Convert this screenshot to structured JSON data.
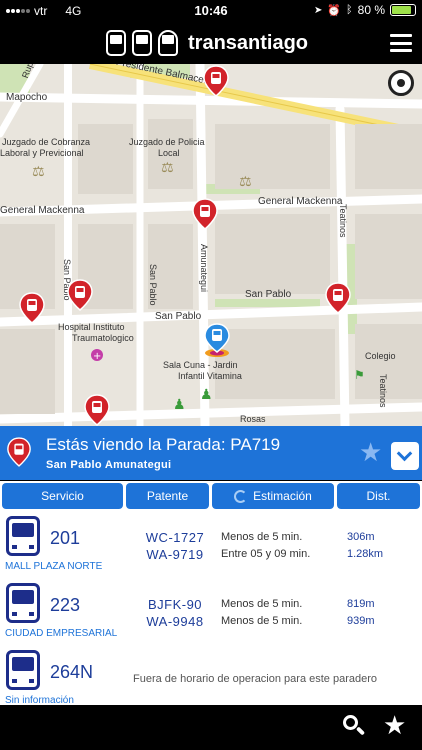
{
  "status_bar": {
    "carrier": "vtr",
    "network": "4G",
    "time": "10:46",
    "battery_text": "80 %"
  },
  "header": {
    "app_name": "transantiago"
  },
  "map": {
    "street_labels": [
      "Presidente Balmaceda",
      "Mapocho",
      "General Mackenna",
      "General Mackenna",
      "San Pablo",
      "San Pablo",
      "Teatinos",
      "Amunategui",
      "San Pablo",
      "San Pablo",
      "Teatinos",
      "Rosas"
    ],
    "place_labels": [
      "Juzgado de Cobranza",
      "Laboral y Previcional",
      "Juzgado de Policia",
      "Local",
      "Hospital Instituto",
      "Traumatologico",
      "Sala Cuna - Jardin",
      "Infantil Vitamina",
      "Colegio",
      "Ruperto Huerta"
    ]
  },
  "stop": {
    "title": "Estás viendo la Parada: PA719",
    "subtitle": "San Pablo Amunategui"
  },
  "table": {
    "headers": [
      "Servicio",
      "Patente",
      "Estimación",
      "Dist."
    ],
    "rows": [
      {
        "route": "201",
        "destination": "MALL PLAZA NORTE",
        "plates": [
          "WC-1727",
          "WA-9719"
        ],
        "estimates": [
          "Menos de 5 min.",
          "Entre 05 y 09 min."
        ],
        "distances": [
          "306m",
          "1.28km"
        ]
      },
      {
        "route": "223",
        "destination": "CIUDAD EMPRESARIAL",
        "plates": [
          "BJFK-90",
          "WA-9948"
        ],
        "estimates": [
          "Menos de 5 min.",
          "Menos de 5 min."
        ],
        "distances": [
          "819m",
          "939m"
        ]
      },
      {
        "route": "264N",
        "destination": "Sin información",
        "message": "Fuera de horario de operacion para este paradero"
      }
    ]
  },
  "colors": {
    "primary_blue": "#1e73d8",
    "route_navy": "#1d2d8a",
    "pin_red": "#d2232a",
    "battery_green": "#9ee14a"
  },
  "icons": [
    "signal-icon",
    "location-arrow-icon",
    "alarm-icon",
    "bluetooth-icon",
    "battery-icon",
    "bus-logo-icon",
    "hamburger-icon",
    "gps-locate-icon",
    "bus-stop-pin-icon",
    "star-icon",
    "chevron-down-icon",
    "refresh-icon",
    "bus-icon",
    "search-icon"
  ]
}
